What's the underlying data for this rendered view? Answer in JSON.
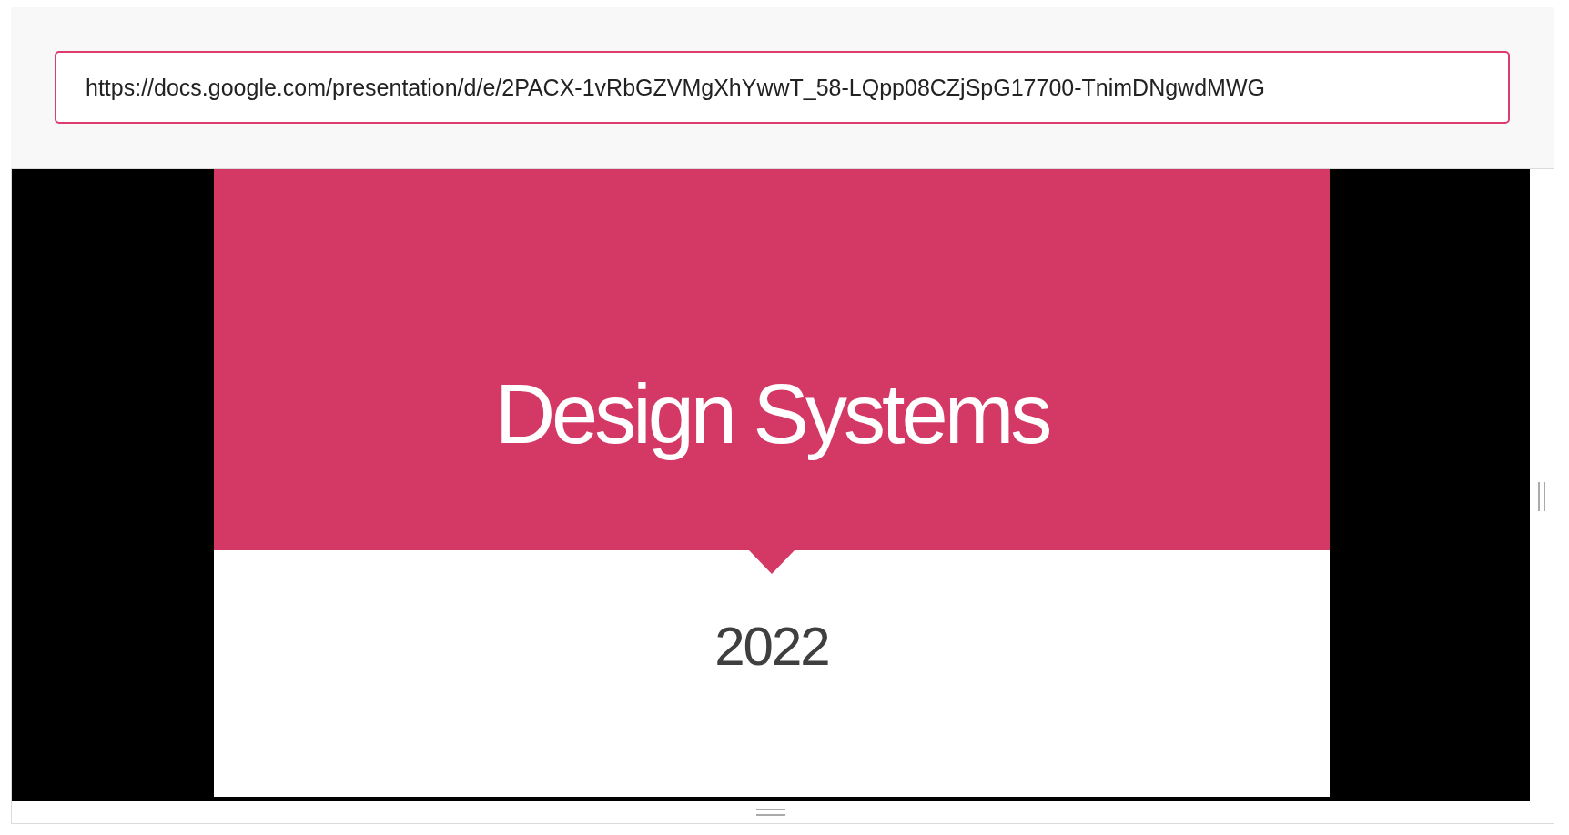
{
  "url_field": {
    "value": "https://docs.google.com/presentation/d/e/2PACX-1vRbGZVMgXhYwwT_58-LQpp08CZjSpG17700-TnimDNgwdMWG"
  },
  "slide": {
    "title": "Design Systems",
    "subtitle": "2022"
  }
}
